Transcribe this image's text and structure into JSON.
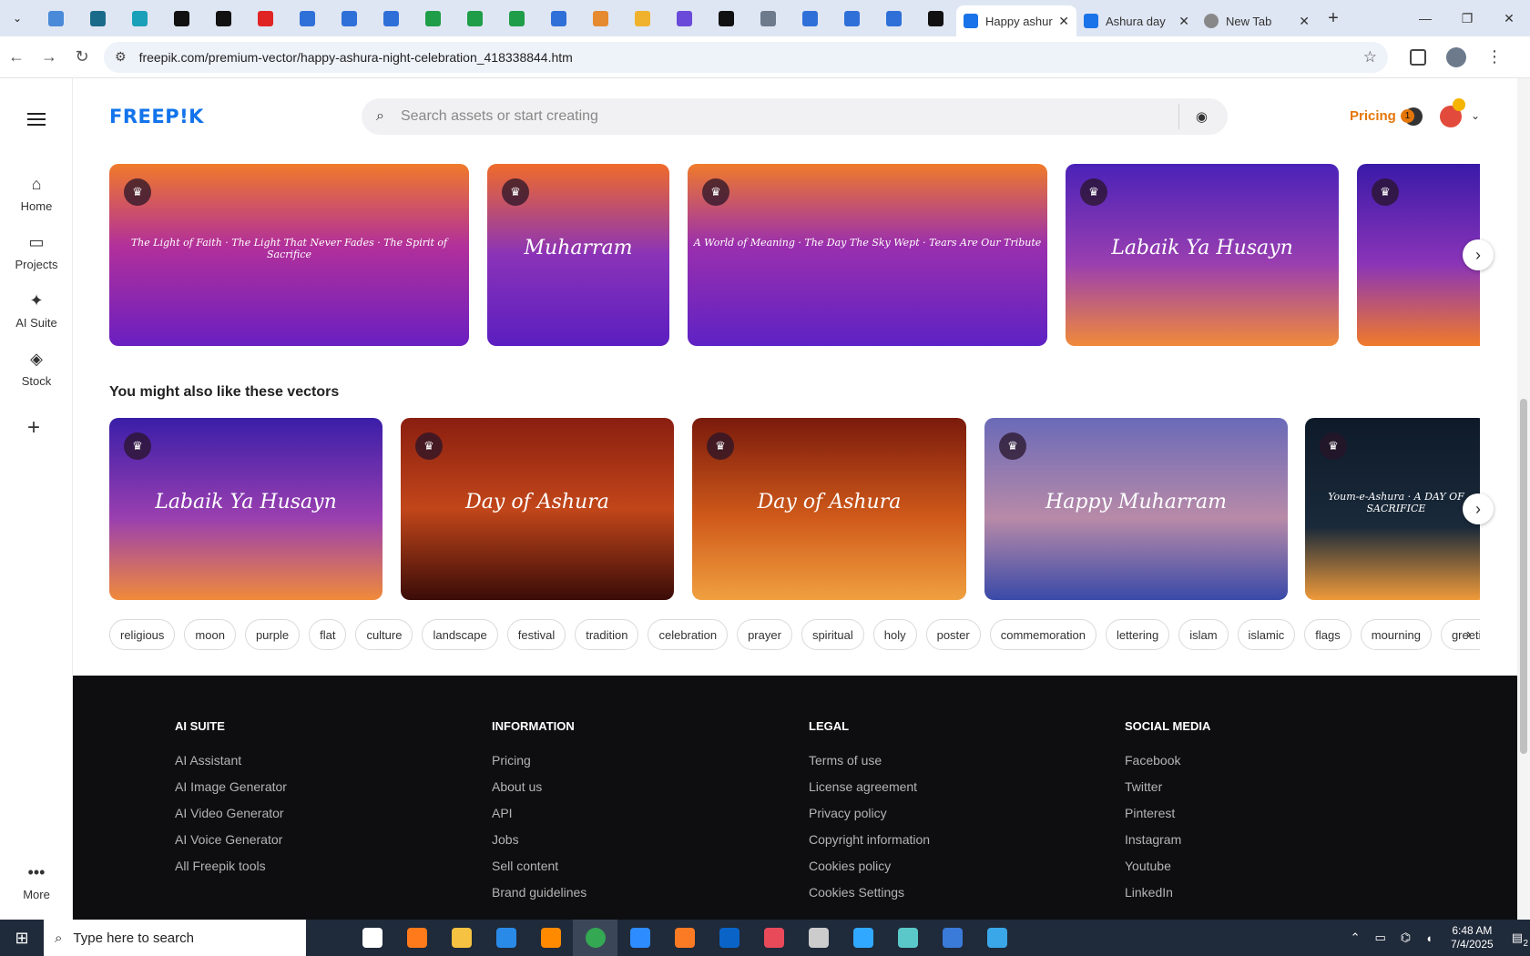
{
  "browser": {
    "tabs": [
      {
        "title": "Happy ashura",
        "active": true
      },
      {
        "title": "Ashura day",
        "active": false
      },
      {
        "title": "New Tab",
        "active": false
      }
    ],
    "pinned_colors": [
      "#4a8ad8",
      "#1a6b8a",
      "#1aa0b8",
      "#111111",
      "#111111",
      "#e02424",
      "#2f6fd8",
      "#2f6fd8",
      "#2f6fd8",
      "#1f9d48",
      "#1f9d48",
      "#1f9d48",
      "#2f6fd8",
      "#e58a2f",
      "#f0b12c",
      "#6a4ad8",
      "#111111",
      "#6c7a8c",
      "#2f6fd8",
      "#2f6fd8",
      "#2f6fd8",
      "#111111"
    ],
    "url": "freepik.com/premium-vector/happy-ashura-night-celebration_418338844.htm",
    "new_tab_symbol": "+"
  },
  "sidebar": {
    "items": [
      {
        "label": "Home",
        "icon": "home-icon",
        "glyph": "⌂"
      },
      {
        "label": "Projects",
        "icon": "folder-icon",
        "glyph": "▭"
      },
      {
        "label": "AI Suite",
        "icon": "sparkle-icon",
        "glyph": "✦"
      },
      {
        "label": "Stock",
        "icon": "stock-icon",
        "glyph": "◈"
      }
    ],
    "more_label": "More"
  },
  "header": {
    "logo": "FREEP!K",
    "search_placeholder": "Search assets or start creating",
    "pricing_label": "Pricing",
    "notification_count": "1"
  },
  "row1_cards": [
    {
      "caption": "The Light of Faith · The Light That Never Fades · The Spirit of Sacrifice",
      "bg": "linear-gradient(180deg,#f07a2a 0%,#b2309a 45%,#6a1fc1 100%)"
    },
    {
      "caption": "Muharram",
      "bg": "linear-gradient(180deg,#f06b2a 0%,#8a33b8 50%,#5b1ec0 100%)"
    },
    {
      "caption": "A World of Meaning · The Day The Sky Wept · Tears Are Our Tribute",
      "bg": "linear-gradient(180deg,#f07a2a 0%,#9a2fae 45%,#5e22c4 100%)"
    },
    {
      "caption": "Labaik Ya Husayn",
      "bg": "linear-gradient(180deg,#4a22b8 0%,#9a3fb0 55%,#f08a3a 100%)"
    },
    {
      "caption": "",
      "bg": "linear-gradient(180deg,#3a1aa8 0%,#8a34b8 55%,#f07a2a 100%)"
    }
  ],
  "section_title": "You might also like these vectors",
  "row2_cards": [
    {
      "caption": "Labaik Ya Husayn",
      "bg": "linear-gradient(180deg,#3a1ea8 0%,#9a3fb0 55%,#f08a3a 100%)"
    },
    {
      "caption": "Day of Ashura",
      "bg": "linear-gradient(180deg,#8a1e10 0%,#c2461a 50%,#3a0c08 100%)"
    },
    {
      "caption": "Day of Ashura",
      "bg": "linear-gradient(180deg,#7a1a0c 0%,#d05a1a 55%,#f0a040 100%)"
    },
    {
      "caption": "Happy Muharram",
      "bg": "linear-gradient(180deg,#6a6ab8 0%,#b88aa8 55%,#3a4aa8 100%)"
    },
    {
      "caption": "Youm-e-Ashura · A DAY OF SACRIFICE",
      "bg": "linear-gradient(180deg,#0e1a2a 0%,#1a2a3a 60%,#f09a3a 100%)"
    }
  ],
  "tags": [
    "religious",
    "moon",
    "purple",
    "flat",
    "culture",
    "landscape",
    "festival",
    "tradition",
    "celebration",
    "prayer",
    "spiritual",
    "holy",
    "poster",
    "commemoration",
    "lettering",
    "islam",
    "islamic",
    "flags",
    "mourning",
    "greeting"
  ],
  "footer": {
    "columns": [
      {
        "heading": "AI SUITE",
        "links": [
          "AI Assistant",
          "AI Image Generator",
          "AI Video Generator",
          "AI Voice Generator",
          "All Freepik tools"
        ]
      },
      {
        "heading": "INFORMATION",
        "links": [
          "Pricing",
          "About us",
          "API",
          "Jobs",
          "Sell content",
          "Brand guidelines"
        ]
      },
      {
        "heading": "LEGAL",
        "links": [
          "Terms of use",
          "License agreement",
          "Privacy policy",
          "Copyright information",
          "Cookies policy",
          "Cookies Settings"
        ]
      },
      {
        "heading": "SOCIAL MEDIA",
        "links": [
          "Facebook",
          "Twitter",
          "Pinterest",
          "Instagram",
          "Youtube",
          "LinkedIn"
        ]
      }
    ]
  },
  "taskbar": {
    "search_placeholder": "Type here to search",
    "apps": [
      {
        "name": "task-view",
        "color": "#ffffff"
      },
      {
        "name": "firefox",
        "color": "#ff7a1a"
      },
      {
        "name": "file-explorer",
        "color": "#f5c242"
      },
      {
        "name": "vscode",
        "color": "#2a8ae8"
      },
      {
        "name": "illustrator",
        "color": "#ff8a00"
      },
      {
        "name": "chrome",
        "color": "#34a853"
      },
      {
        "name": "zoom",
        "color": "#2d8cff"
      },
      {
        "name": "xampp",
        "color": "#fb7a24"
      },
      {
        "name": "outlook",
        "color": "#0a64c8"
      },
      {
        "name": "creative-cloud",
        "color": "#e84a5a"
      },
      {
        "name": "pen-tool",
        "color": "#cccccc"
      },
      {
        "name": "photoshop",
        "color": "#31a8ff"
      },
      {
        "name": "sketch-app",
        "color": "#5ac8c8"
      },
      {
        "name": "wireshark",
        "color": "#3a7ad8"
      },
      {
        "name": "paint",
        "color": "#3aa8e8"
      }
    ],
    "time": "6:48 AM",
    "date": "7/4/2025",
    "notification_count": "2"
  }
}
